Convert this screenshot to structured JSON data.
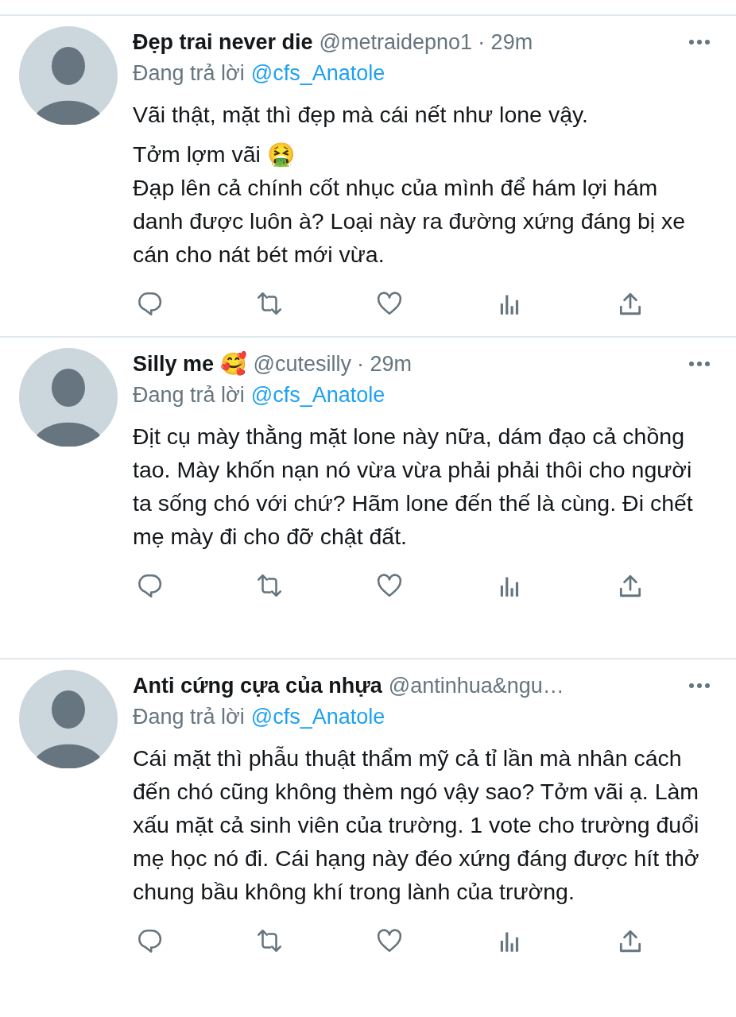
{
  "tweets": [
    {
      "name": "Đẹp trai never die",
      "handle": "@metraidepno1",
      "time": "· 29m",
      "reply_label": "Đang trả lời",
      "reply_to": "@cfs_Anatole",
      "paragraphs": [
        "Vãi thật, mặt thì đẹp mà cái nết như lone vậy.",
        "Tởm lợm vãi 🤮\nĐạp lên cả chính cốt nhục của mình để hám lợi hám danh được luôn à? Loại này ra đường xứng đáng bị xe cán cho nát bét mới vừa."
      ]
    },
    {
      "name": "Silly me 🥰",
      "handle": "@cutesilly",
      "time": "· 29m",
      "reply_label": "Đang trả lời",
      "reply_to": "@cfs_Anatole",
      "paragraphs": [
        "Địt cụ mày thằng mặt lone này nữa, dám đạo cả chồng tao. Mày khốn nạn nó vừa vừa phải phải thôi cho người ta sống chó với chứ? Hãm lone đến thế là cùng. Đi chết mẹ mày đi cho đỡ chật đất."
      ]
    },
    {
      "name": "Anti cứng cựa của nhựa",
      "handle": "@antinhua&ngu…",
      "reply_label": "Đang trả lời",
      "reply_to": "@cfs_Anatole",
      "paragraphs": [
        "Cái mặt thì phẫu thuật thẩm mỹ cả tỉ lần mà nhân cách đến chó cũng không thèm ngó vậy sao? Tởm vãi ạ. Làm xấu mặt cả sinh viên của trường. 1 vote cho trường đuổi mẹ học nó đi. Cái hạng này đéo xứng đáng được hít thở chung bầu không khí trong lành của trường."
      ]
    }
  ]
}
